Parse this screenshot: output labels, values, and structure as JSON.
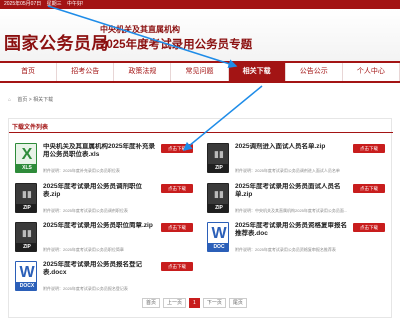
{
  "topbar": {
    "date": "2025年05月07日",
    "weekday": "星期三",
    "greeting": "中午好!"
  },
  "header": {
    "logo": "国家公务员局",
    "org": "中央机关及其直属机构",
    "title": "2025年度考试录用公务员专题"
  },
  "nav": [
    "首页",
    "招考公告",
    "政策法规",
    "常见问题",
    "相关下载",
    "公告公示",
    "个人中心"
  ],
  "breadcrumb": {
    "home": "首页",
    "separator": ">",
    "current": "相关下载"
  },
  "section_title": "下载文件列表",
  "download_label": "点击下载",
  "files": [
    {
      "icon": "excel-icon",
      "ext": "XLS",
      "name": "中央机关及其直属机构2025年度补充录用公务员职位表.xls",
      "desc": "附件说明：2025年度补充录用公务员职位表"
    },
    {
      "icon": "zip-icon",
      "ext": "ZIP",
      "name": "2025调剂进入面试人员名单.zip",
      "desc": "附件说明：2025年度考试录用公务员调剂进入面试人员名单"
    },
    {
      "icon": "zip-icon",
      "ext": "ZIP",
      "name": "2025年度考试录用公务员调剂职位表.zip",
      "desc": "附件说明：2025年度考试录用公务员调剂职位表"
    },
    {
      "icon": "zip-icon",
      "ext": "ZIP",
      "name": "2025年度考试录用公务员面试人员名单.zip",
      "desc": "附件说明：中央机关及其直属机构2025年度考试录用公务员面..."
    },
    {
      "icon": "zip-icon",
      "ext": "ZIP",
      "name": "2025年度考试录用公务员职位简章.zip",
      "desc": "附件说明：2025年度考试录用公务员职位简章"
    },
    {
      "icon": "word-icon",
      "ext": "DOC",
      "name": "2025年度考试录用公务员资格复审报名推荐表.doc",
      "desc": "附件说明：2025年度考试录用公务员资格复审报名推荐表"
    },
    {
      "icon": "word-icon",
      "ext": "DOCX",
      "name": "2025年度考试录用公务员报名登记表.docx",
      "desc": "附件说明：2025年度考试录用公务员报名登记表"
    }
  ],
  "pager": {
    "first": "首页",
    "prev": "上一页",
    "current": "1",
    "next": "下一页",
    "last": "尾页"
  },
  "colors": {
    "brand": "#a31414",
    "button": "#c81d1d",
    "annotation_arrow": "#1e8ce8"
  }
}
